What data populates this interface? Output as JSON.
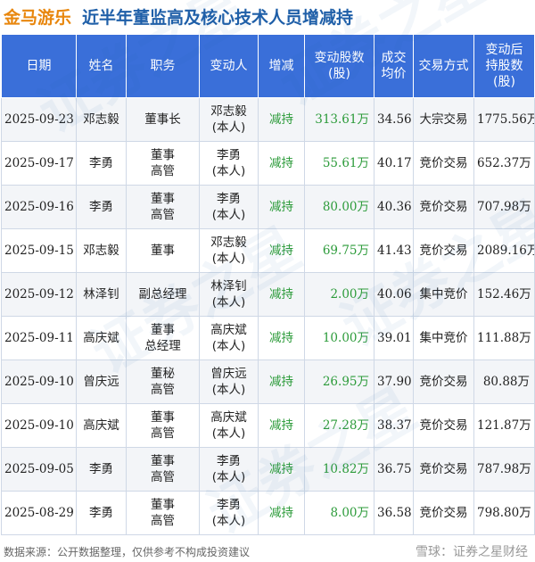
{
  "header": {
    "company": "金马游乐",
    "title": "近半年董监高及核心技术人员增减持"
  },
  "table": {
    "columns": [
      "日期",
      "姓名",
      "职务",
      "变动人",
      "增减",
      "变动股数\n(股)",
      "成交\n均价",
      "交易方式",
      "变动后\n持股数\n(股)"
    ],
    "rows": [
      {
        "date": "2025-09-23",
        "name": "邓志毅",
        "position": "董事长",
        "changer": "邓志毅\n(本人)",
        "direction": "减持",
        "shares": "313.61万",
        "price": "34.56",
        "method": "大宗交易",
        "holding": "1775.56万"
      },
      {
        "date": "2025-09-17",
        "name": "李勇",
        "position": "董事\n高管",
        "changer": "李勇\n(本人)",
        "direction": "减持",
        "shares": "55.61万",
        "price": "40.17",
        "method": "竞价交易",
        "holding": "652.37万"
      },
      {
        "date": "2025-09-16",
        "name": "李勇",
        "position": "董事\n高管",
        "changer": "李勇\n(本人)",
        "direction": "减持",
        "shares": "80.00万",
        "price": "40.36",
        "method": "竞价交易",
        "holding": "707.98万"
      },
      {
        "date": "2025-09-15",
        "name": "邓志毅",
        "position": "董事",
        "changer": "邓志毅\n(本人)",
        "direction": "减持",
        "shares": "69.75万",
        "price": "41.43",
        "method": "竞价交易",
        "holding": "2089.16万"
      },
      {
        "date": "2025-09-12",
        "name": "林泽钊",
        "position": "副总经理",
        "changer": "林泽钊\n(本人)",
        "direction": "减持",
        "shares": "2.00万",
        "price": "40.06",
        "method": "集中竞价",
        "holding": "152.46万"
      },
      {
        "date": "2025-09-11",
        "name": "高庆斌",
        "position": "董事\n总经理",
        "changer": "高庆斌\n(本人)",
        "direction": "减持",
        "shares": "10.00万",
        "price": "39.01",
        "method": "集中竞价",
        "holding": "111.88万"
      },
      {
        "date": "2025-09-10",
        "name": "曾庆远",
        "position": "董秘\n高管",
        "changer": "曾庆远\n(本人)",
        "direction": "减持",
        "shares": "26.95万",
        "price": "37.90",
        "method": "竞价交易",
        "holding": "80.88万"
      },
      {
        "date": "2025-09-10",
        "name": "高庆斌",
        "position": "董事\n高管",
        "changer": "高庆斌\n(本人)",
        "direction": "减持",
        "shares": "27.28万",
        "price": "38.37",
        "method": "竞价交易",
        "holding": "121.87万"
      },
      {
        "date": "2025-09-05",
        "name": "李勇",
        "position": "董事\n高管",
        "changer": "李勇\n(本人)",
        "direction": "减持",
        "shares": "10.82万",
        "price": "36.75",
        "method": "竞价交易",
        "holding": "787.98万"
      },
      {
        "date": "2025-08-29",
        "name": "李勇",
        "position": "董事\n高管",
        "changer": "李勇\n(本人)",
        "direction": "减持",
        "shares": "8.00万",
        "price": "36.58",
        "method": "竞价交易",
        "holding": "798.80万"
      }
    ]
  },
  "footer": {
    "source": "数据来源：公开数据整理，仅供参考不构成投资建议",
    "brand": "雪球：证券之星财经"
  },
  "watermark": {
    "text": "证券之星"
  },
  "colors": {
    "header_bg": "#3a6fd9",
    "title_company": "#e8870e",
    "title_text": "#1f5fa8",
    "decrease_green": "#2c9b3a"
  }
}
